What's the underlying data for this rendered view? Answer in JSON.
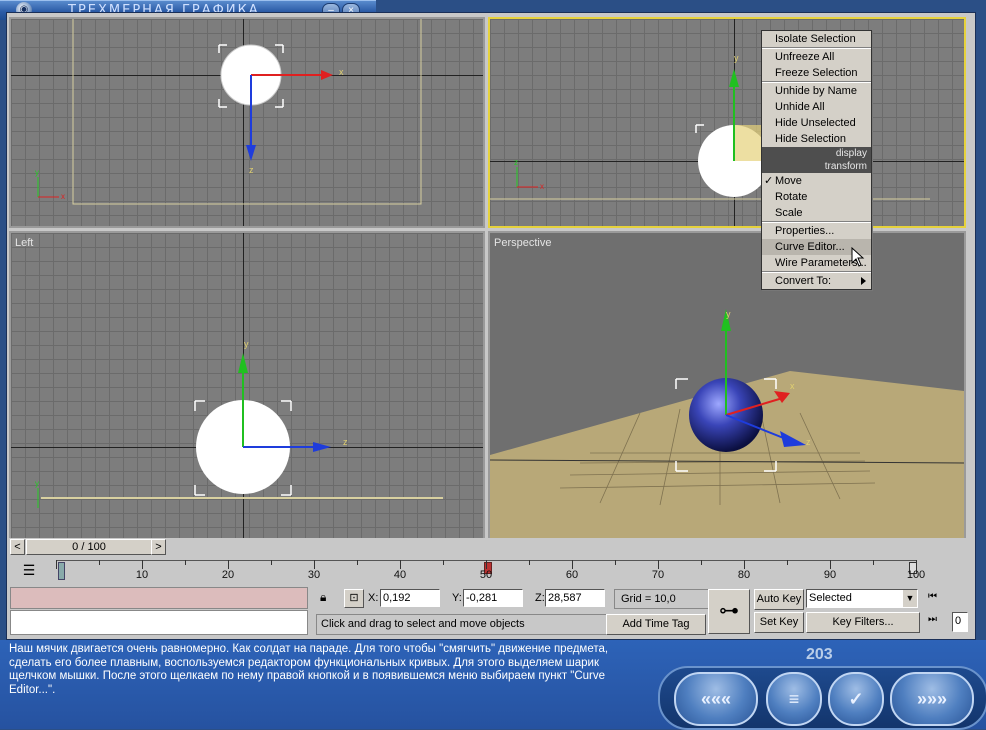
{
  "window": {
    "title": "ТРЕХМЕРНАЯ ГРАФИКА",
    "minimize": "–",
    "close": "×"
  },
  "viewports": {
    "left_label": "Left",
    "perspective_label": "Perspective"
  },
  "context_menu": {
    "display_header": "display",
    "transform_header": "transform",
    "display_items": [
      "Isolate Selection",
      "Unfreeze All",
      "Freeze Selection",
      "Unhide by Name",
      "Unhide All",
      "Hide Unselected",
      "Hide Selection"
    ],
    "transform_items": [
      "Move",
      "Rotate",
      "Scale",
      "Properties...",
      "Curve Editor...",
      "Wire Parameters...",
      "Convert To:"
    ],
    "checked": "Move",
    "highlighted": "Curve Editor..."
  },
  "timeslider": {
    "label": "0 / 100",
    "prev": "<",
    "next": ">"
  },
  "track": {
    "labels": [
      "10",
      "20",
      "30",
      "40",
      "50",
      "60",
      "70",
      "80",
      "90",
      "100"
    ],
    "current_frame": 0
  },
  "status": {
    "x_label": "X:",
    "x": "0,192",
    "y_label": "Y:",
    "y": "-0,281",
    "z_label": "Z:",
    "z": "28,587",
    "grid": "Grid = 10,0",
    "prompt": "Click and drag to select and move objects",
    "add_time_tag": "Add Time Tag",
    "auto_key": "Auto Key",
    "set_key": "Set Key",
    "selected": "Selected",
    "key_filters": "Key Filters...",
    "frame_field": "0"
  },
  "lesson": {
    "text": "Наш мячик двигается очень равномерно. Как солдат на параде. Для того чтобы \"смягчить\" движение предмета, сделать его более плавным, воспользуемся редактором функциональных кривых. Для этого выделяем шарик щелчком мышки. После этого щелкаем по нему правой кнопкой и в появившемся меню выбираем пункт \"Curve Editor...\".",
    "page": "203"
  },
  "nav": {
    "back": "«««",
    "menu": "≡",
    "check": "✓",
    "forward": "»»»"
  },
  "colors": {
    "accent": "#2b4f86",
    "selection_yellow": "#e6d23c",
    "floor": "#b8a878"
  }
}
